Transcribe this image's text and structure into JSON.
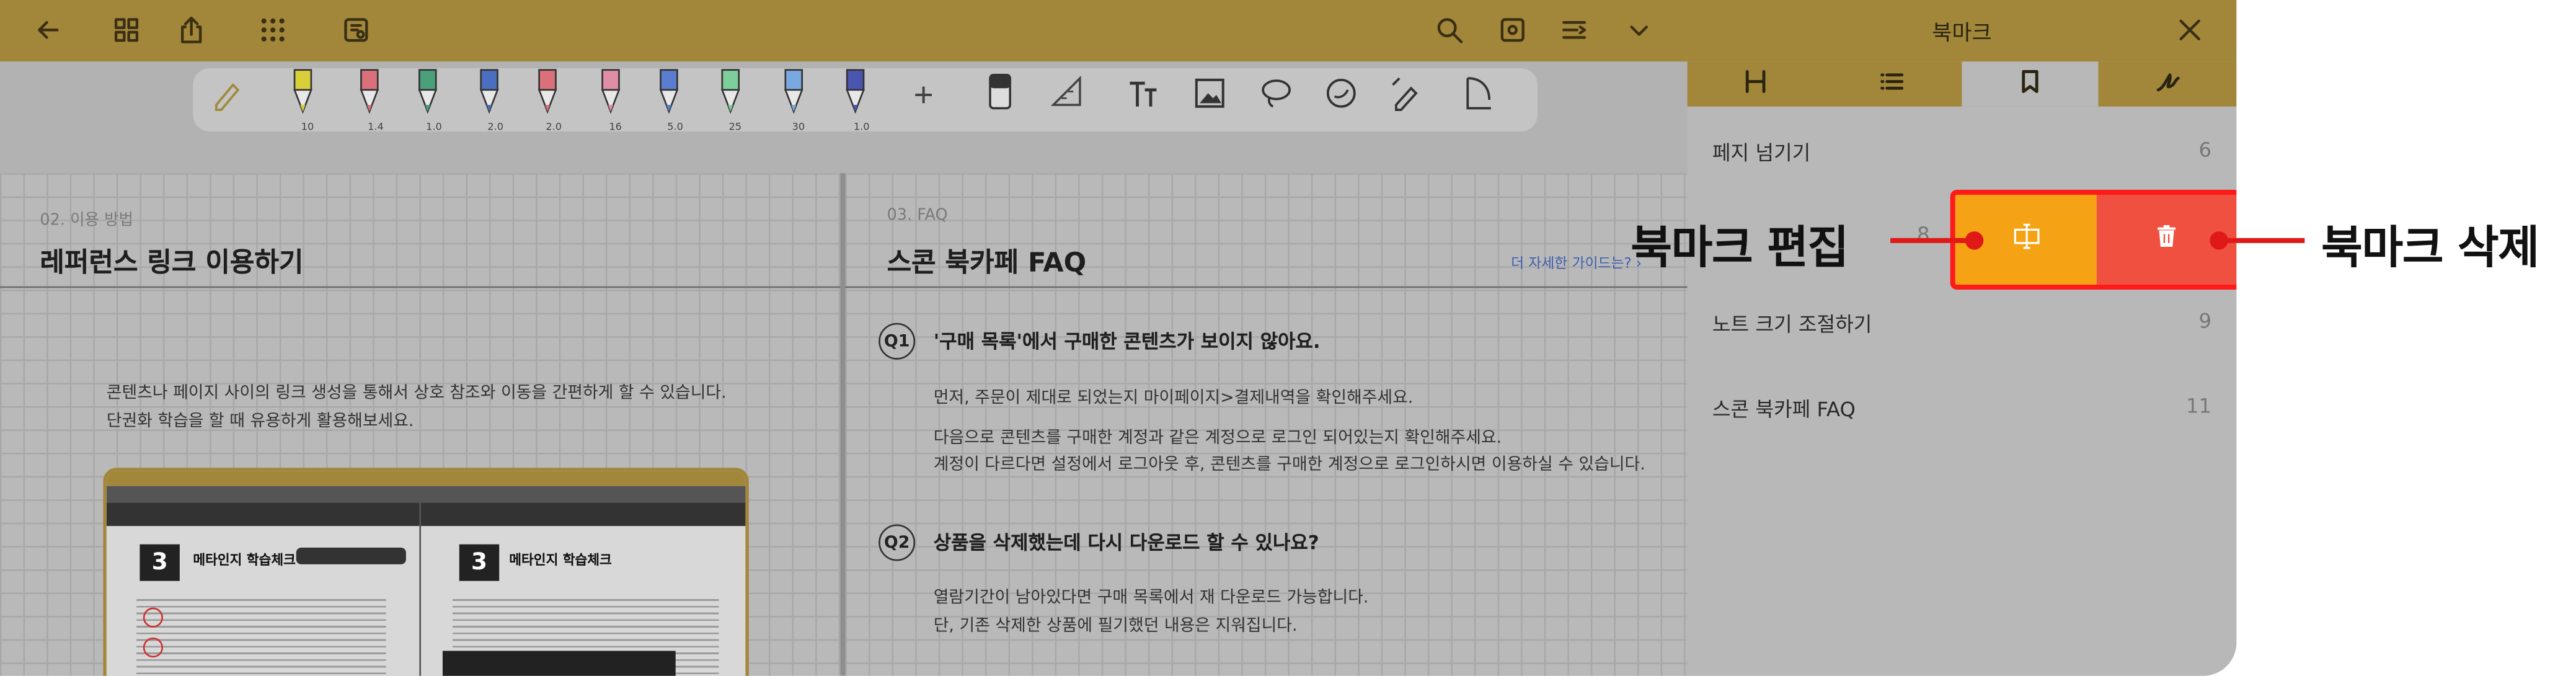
{
  "toolbar": {
    "icons": [
      "back-arrow-icon",
      "grid-icon",
      "export-icon",
      "apps-icon",
      "settings-book-icon",
      "search-icon",
      "page-settings-icon",
      "list-indent-icon",
      "chevron-down-icon"
    ]
  },
  "pens": [
    {
      "name": "highlighter-yellow",
      "size": "10",
      "color": "#d9cf3a"
    },
    {
      "name": "pen-red",
      "size": "1.4",
      "color": "#d9707a"
    },
    {
      "name": "fountain-pen-green",
      "size": "1.0",
      "color": "#4aa07a"
    },
    {
      "name": "pen-blue",
      "size": "2.0",
      "color": "#4a6fc0"
    },
    {
      "name": "pen-ruled-red",
      "size": "2.0",
      "color": "#d9707a"
    },
    {
      "name": "pen-pink",
      "size": "16",
      "color": "#e08ea6"
    },
    {
      "name": "pen-blue-ruled",
      "size": "5.0",
      "color": "#5a7dd0"
    },
    {
      "name": "marker-green",
      "size": "25",
      "color": "#7ccf9a"
    },
    {
      "name": "marker-blue",
      "size": "30",
      "color": "#7aa8e0"
    },
    {
      "name": "pen-navy",
      "size": "1.0",
      "color": "#4a55b0"
    }
  ],
  "left_page": {
    "section_label": "02. 이용 방법",
    "title": "레퍼런스 링크 이용하기",
    "body_line1": "콘텐츠나 페이지 사이의 링크 생성을 통해서 상호 참조와 이동을 간편하게 할 수 있습니다.",
    "body_line2": "단권화 학습을 할 때 유용하게 활용해보세요.",
    "thumb_title_left": "메타인지 학습체크",
    "thumb_title_right": "메타인지 학습체크",
    "thumb_chapter": "3"
  },
  "right_page": {
    "section_label": "03. FAQ",
    "title": "스콘 북카페 FAQ",
    "more_link": "더 자세한 가이드는? ›",
    "q1_badge": "Q1",
    "q1_title": "'구매 목록'에서 구매한 콘텐츠가 보이지 않아요.",
    "q1_a1": "먼저, 주문이 제대로 되었는지 마이페이지>결제내역을 확인해주세요.",
    "q1_a2": "다음으로 콘텐츠를 구매한 계정과 같은 계정으로 로그인 되어있는지 확인해주세요.",
    "q1_a3": "계정이 다르다면 설정에서 로그아웃 후, 콘텐츠를 구매한 계정으로 로그인하시면 이용하실 수 있습니다.",
    "q2_badge": "Q2",
    "q2_title": "상품을 삭제했는데 다시 다운로드 할 수 있나요?",
    "q2_a1": "열람기간이 남아있다면 구매 목록에서 재 다운로드 가능합니다.",
    "q2_a2": "단, 기존 삭제한 상품에 필기했던 내용은 지워집니다."
  },
  "panel": {
    "title": "북마크",
    "tabs": [
      "outline-icon",
      "list-icon",
      "bookmark-icon",
      "handwriting-icon"
    ],
    "active_tab": 2,
    "bookmarks": [
      {
        "label": "페지 넘기기",
        "page": "6"
      },
      {
        "label": "",
        "page": "8"
      },
      {
        "label": "노트 크기 조절하기",
        "page": "9"
      },
      {
        "label": "스콘 북카페 FAQ",
        "page": "11"
      }
    ],
    "swipe_actions": {
      "edit_color": "#f5a314",
      "delete_color": "#f05040",
      "highlight_border": "#ff1a1a"
    }
  },
  "callouts": {
    "edit": "북마크 편집",
    "delete": "북마크 삭제"
  }
}
